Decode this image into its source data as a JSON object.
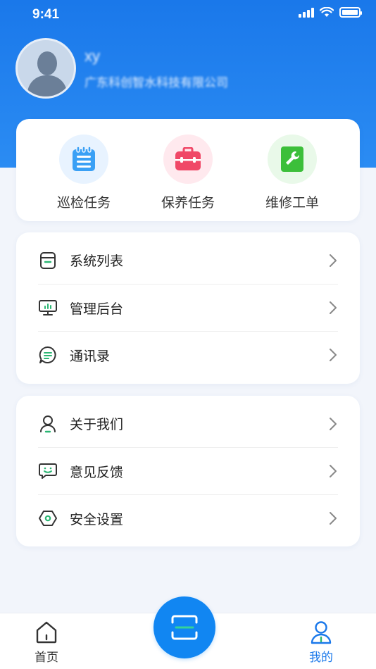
{
  "status_bar": {
    "time": "9:41"
  },
  "profile": {
    "name": "xy",
    "organization": "广东科创智水科技有限公司"
  },
  "quick_actions": [
    {
      "label": "巡检任务",
      "icon": "clipboard-icon",
      "color": "#3aa0f5",
      "bg": "#e8f3ff"
    },
    {
      "label": "保养任务",
      "icon": "toolbox-icon",
      "color": "#f04867",
      "bg": "#ffe9ee"
    },
    {
      "label": "维修工单",
      "icon": "wrench-icon",
      "color": "#3cbf3a",
      "bg": "#e9f9e9"
    }
  ],
  "menu_group_1": [
    {
      "label": "系统列表",
      "icon": "box-icon"
    },
    {
      "label": "管理后台",
      "icon": "monitor-icon"
    },
    {
      "label": "通讯录",
      "icon": "chat-icon"
    }
  ],
  "menu_group_2": [
    {
      "label": "关于我们",
      "icon": "user-icon"
    },
    {
      "label": "意见反馈",
      "icon": "feedback-icon"
    },
    {
      "label": "安全设置",
      "icon": "hexagon-gear-icon"
    }
  ],
  "tabbar": {
    "home_label": "首页",
    "mine_label": "我的",
    "active_color": "#1a78ea",
    "inactive_color": "#333333"
  },
  "colors": {
    "accent": "#1a78ea",
    "green": "#2bb673"
  }
}
